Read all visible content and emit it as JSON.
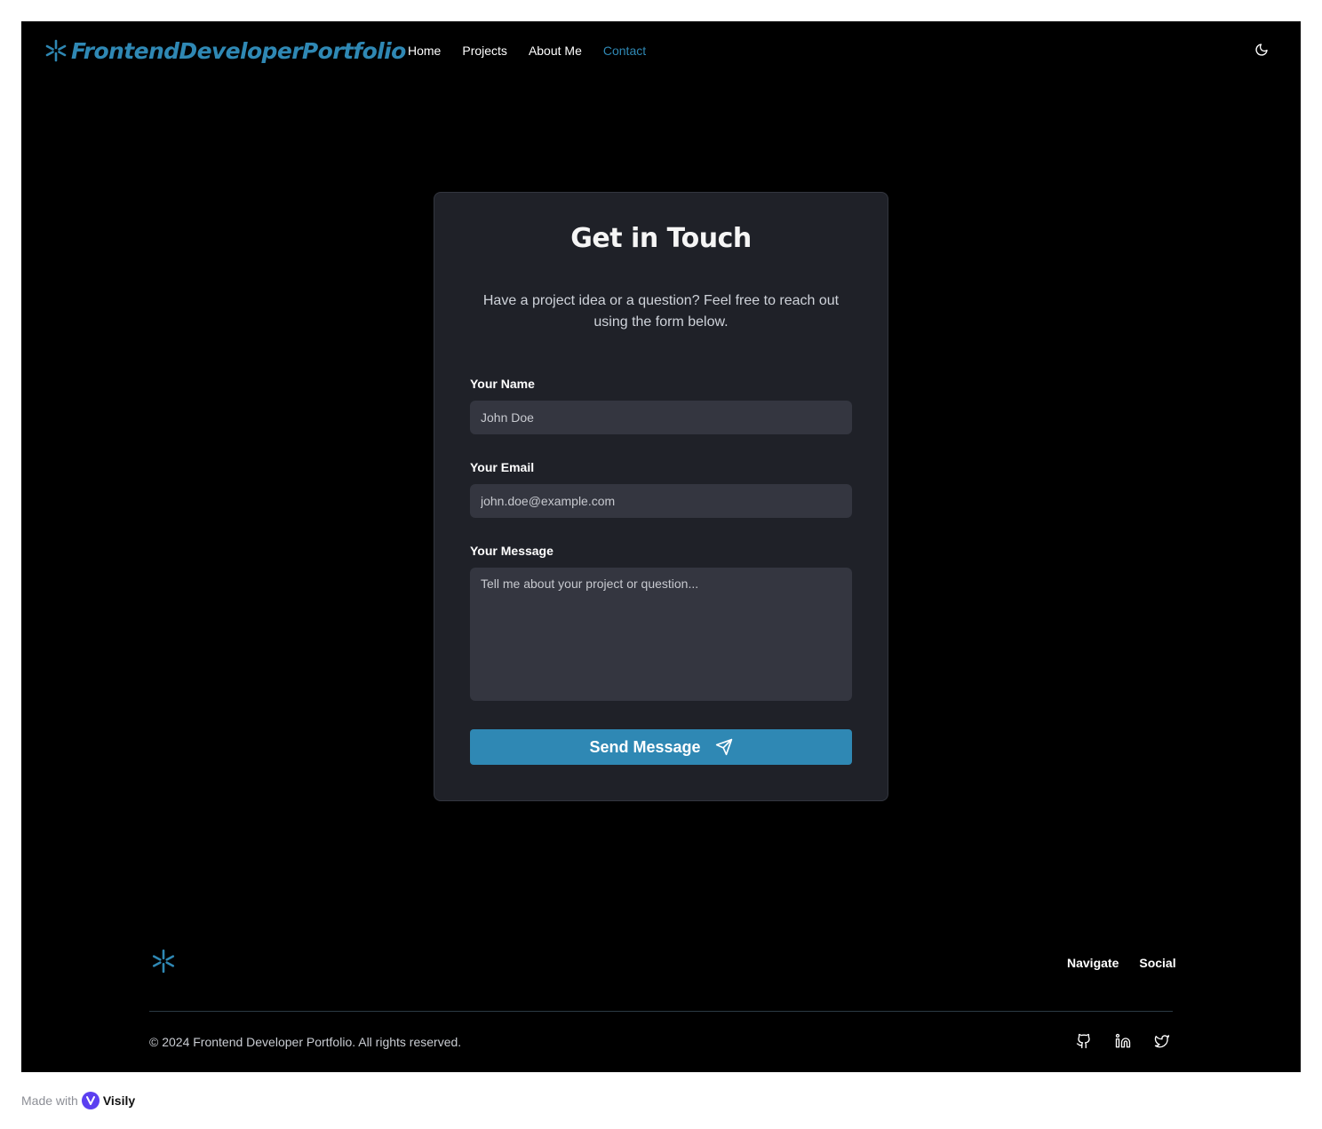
{
  "header": {
    "brand": "FrontendDeveloperPortfolio",
    "nav": [
      {
        "label": "Home",
        "active": false
      },
      {
        "label": "Projects",
        "active": false
      },
      {
        "label": "About Me",
        "active": false
      },
      {
        "label": "Contact",
        "active": true
      }
    ],
    "theme_icon": "moon-icon"
  },
  "contact": {
    "title": "Get in Touch",
    "subtitle": "Have a project idea or a question? Feel free to reach out using the form below.",
    "name_label": "Your Name",
    "name_placeholder": "John Doe",
    "email_label": "Your Email",
    "email_placeholder": "john.doe@example.com",
    "message_label": "Your Message",
    "message_placeholder": "Tell me about your project or question...",
    "submit_label": "Send Message",
    "submit_icon": "send-icon"
  },
  "footer": {
    "nav": [
      "Navigate",
      "Social"
    ],
    "copyright": "© 2024 Frontend Developer Portfolio. All rights reserved.",
    "social_icons": [
      "github-icon",
      "linkedin-icon",
      "twitter-icon"
    ]
  },
  "badge": {
    "made_with": "Made with",
    "brand": "Visily"
  },
  "colors": {
    "accent": "#2f88b4",
    "background": "#000000",
    "card": "#1f2128",
    "input": "#343640"
  }
}
